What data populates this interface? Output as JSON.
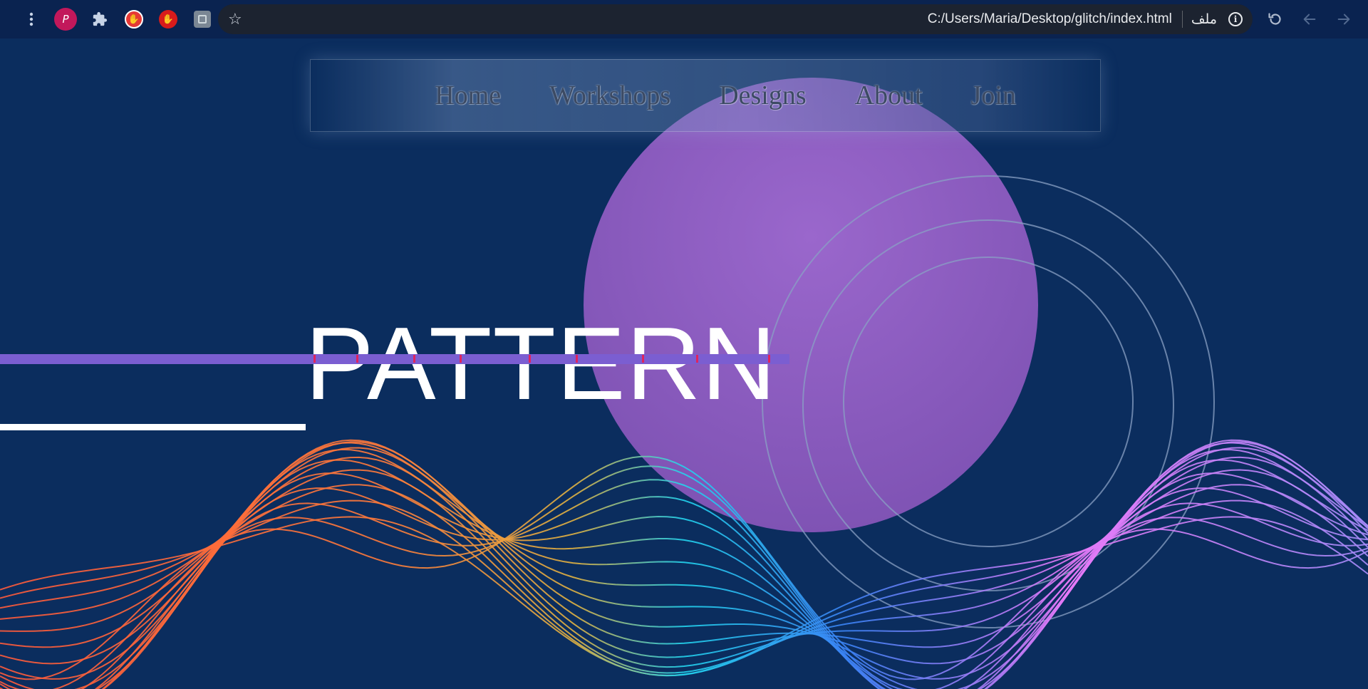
{
  "browser": {
    "profile_initial": "P",
    "address_url": "C:/Users/Maria/Desktop/glitch/index.html",
    "protocol_label": "ملف",
    "icons": {
      "menu": "more-vertical-icon",
      "extensions": "puzzle-icon",
      "star": "bookmark-star-icon",
      "info": "site-info-icon",
      "reload": "reload-icon",
      "back": "back-arrow-icon",
      "forward": "forward-arrow-icon"
    }
  },
  "nav": {
    "items": [
      {
        "label": "Home"
      },
      {
        "label": "Workshops"
      },
      {
        "label": "Designs"
      },
      {
        "label": "About"
      },
      {
        "label": "Join"
      }
    ]
  },
  "hero": {
    "title": "PATTERN"
  },
  "colors": {
    "page_background": "#0b2d5e",
    "circle_fill": "#8a5cc0",
    "glitch_bar": "#7b5ed1",
    "wave_warm": "#ff6a3d",
    "wave_cyan": "#22d3ee",
    "wave_pink": "#e879f9"
  }
}
